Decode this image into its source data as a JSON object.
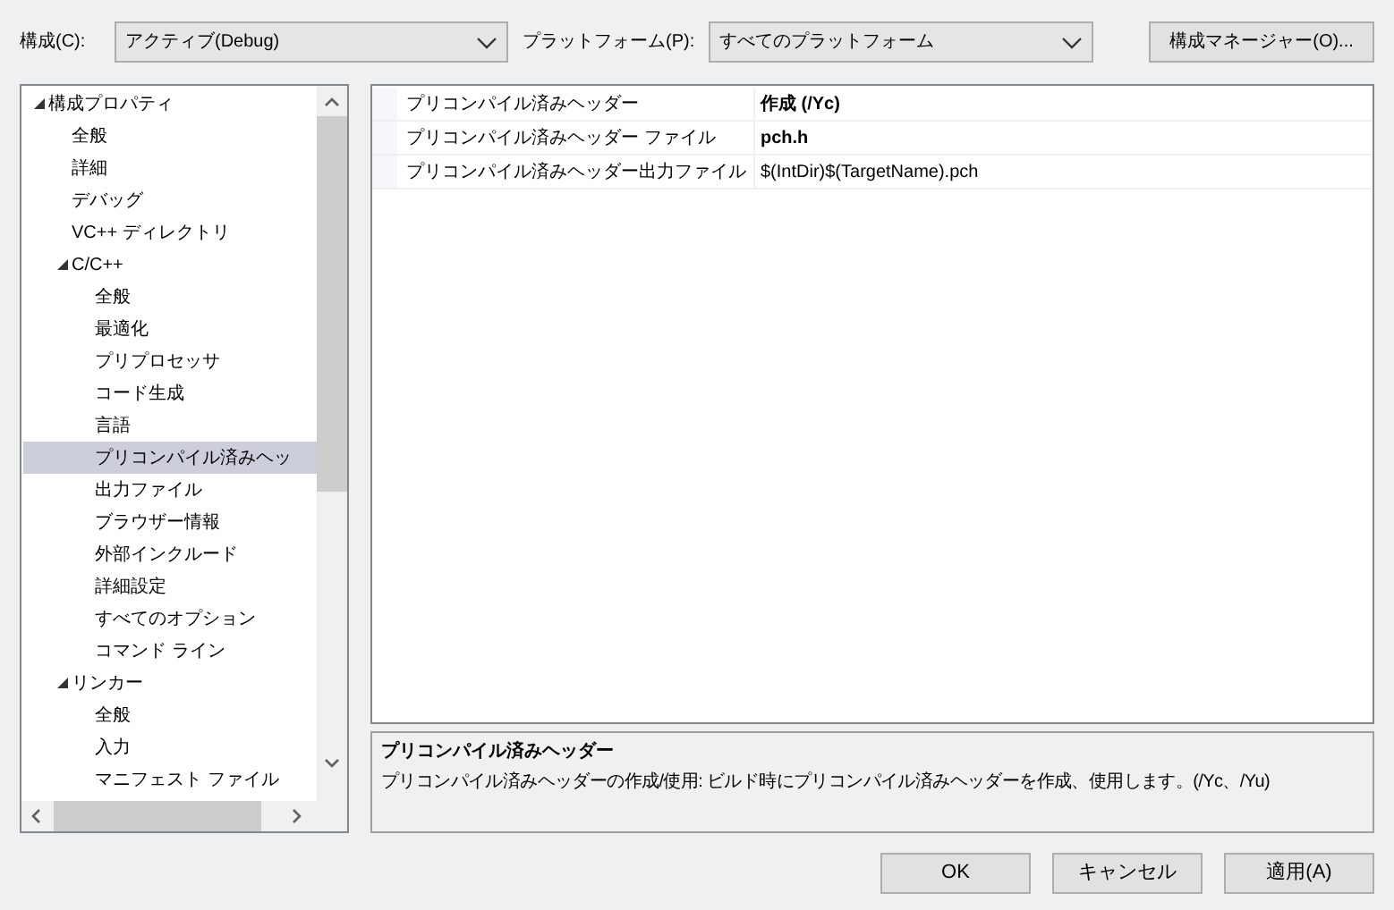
{
  "toolbar": {
    "config_label": "構成(C):",
    "config_value": "アクティブ(Debug)",
    "platform_label": "プラットフォーム(P):",
    "platform_value": "すべてのプラットフォーム",
    "manager_button": "構成マネージャー(O)..."
  },
  "tree": [
    {
      "label": "構成プロパティ",
      "expanded": true,
      "selected": false,
      "children": [
        {
          "label": "全般",
          "selected": false
        },
        {
          "label": "詳細",
          "selected": false
        },
        {
          "label": "デバッグ",
          "selected": false
        },
        {
          "label": "VC++ ディレクトリ",
          "selected": false
        },
        {
          "label": "C/C++",
          "expanded": true,
          "selected": false,
          "children": [
            {
              "label": "全般",
              "selected": false
            },
            {
              "label": "最適化",
              "selected": false
            },
            {
              "label": "プリプロセッサ",
              "selected": false
            },
            {
              "label": "コード生成",
              "selected": false
            },
            {
              "label": "言語",
              "selected": false
            },
            {
              "label": "プリコンパイル済みヘッ",
              "selected": true
            },
            {
              "label": "出力ファイル",
              "selected": false
            },
            {
              "label": "ブラウザー情報",
              "selected": false
            },
            {
              "label": "外部インクルード",
              "selected": false
            },
            {
              "label": "詳細設定",
              "selected": false
            },
            {
              "label": "すべてのオプション",
              "selected": false
            },
            {
              "label": "コマンド ライン",
              "selected": false
            }
          ]
        },
        {
          "label": "リンカー",
          "expanded": true,
          "selected": false,
          "children": [
            {
              "label": "全般",
              "selected": false
            },
            {
              "label": "入力",
              "selected": false
            },
            {
              "label": "マニフェスト ファイル",
              "selected": false
            }
          ]
        }
      ]
    }
  ],
  "properties": [
    {
      "name": "プリコンパイル済みヘッダー",
      "value": "作成 (/Yc)",
      "bold": true
    },
    {
      "name": "プリコンパイル済みヘッダー ファイル",
      "value": "pch.h",
      "bold": true
    },
    {
      "name": "プリコンパイル済みヘッダー出力ファイル",
      "value": "$(IntDir)$(TargetName).pch",
      "bold": false
    }
  ],
  "description": {
    "title": "プリコンパイル済みヘッダー",
    "text": "プリコンパイル済みヘッダーの作成/使用: ビルド時にプリコンパイル済みヘッダーを作成、使用します。(/Yc、/Yu)"
  },
  "buttons": [
    "OK",
    "キャンセル",
    "適用(A)"
  ]
}
